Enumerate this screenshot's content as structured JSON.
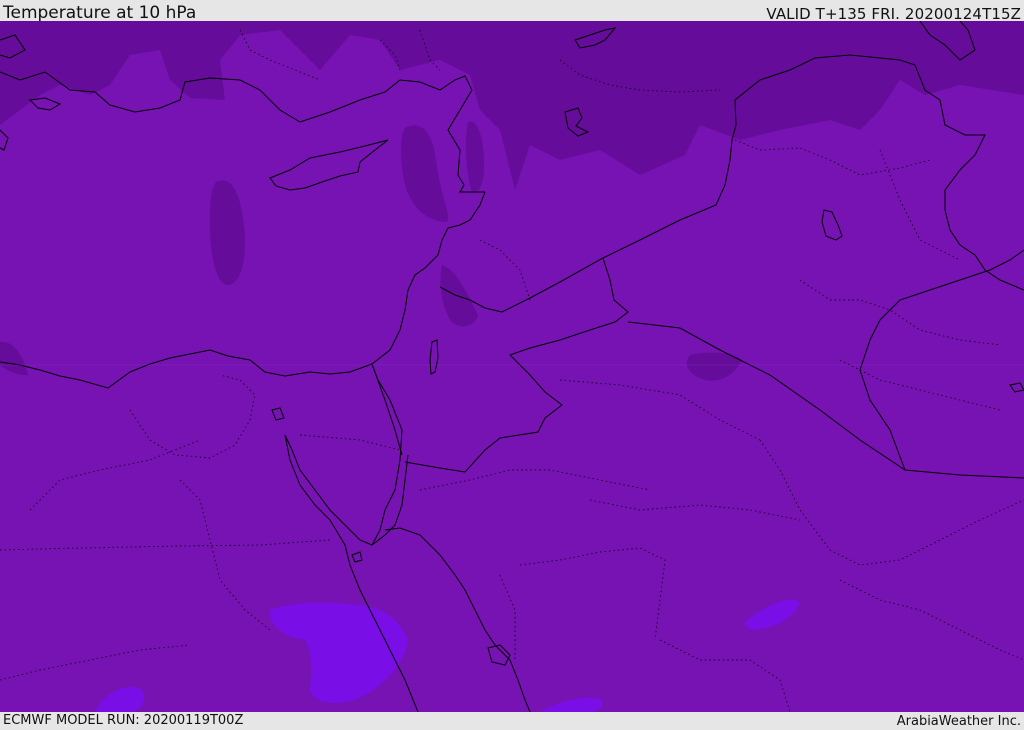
{
  "header": {
    "title": "Temperature at 10 hPa",
    "valid": "VALID T+135 FRI. 20200124T15Z"
  },
  "footer": {
    "model_run": "ECMWF MODEL RUN: 20200119T00Z",
    "credit": "ArabiaWeather Inc."
  },
  "map": {
    "colors": {
      "base": "#7713b3",
      "cold": "#660c9a",
      "warm": "#7a0ee6",
      "coast": "#000000"
    }
  }
}
